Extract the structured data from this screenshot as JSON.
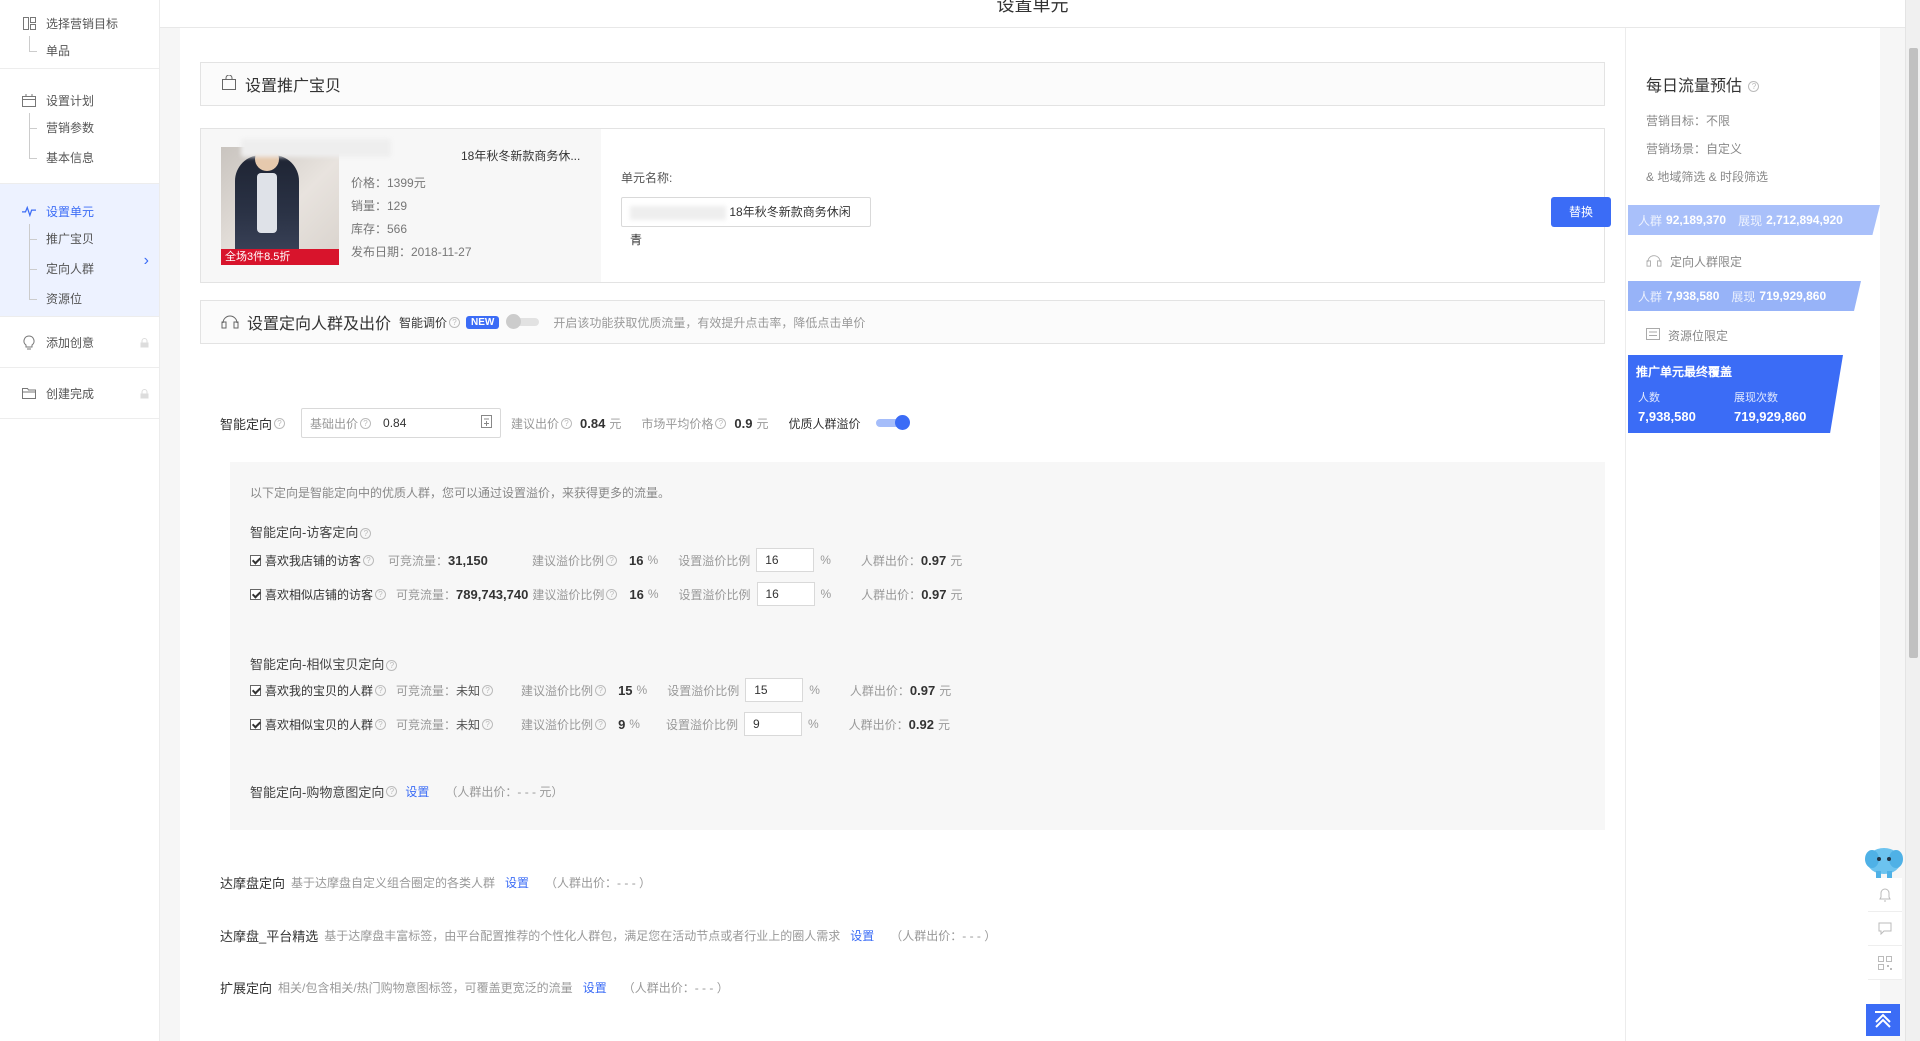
{
  "sidebar": {
    "sections": [
      {
        "title": "选择营销目标",
        "subs": [
          "单品"
        ]
      },
      {
        "title": "设置计划",
        "subs": [
          "营销参数",
          "基本信息"
        ]
      },
      {
        "title": "设置单元",
        "subs": [
          "推广宝贝",
          "定向人群",
          "资源位"
        ]
      },
      {
        "title": "添加创意",
        "subs": []
      },
      {
        "title": "创建完成",
        "subs": []
      }
    ]
  },
  "page_title": "设置单元",
  "item_section": {
    "title": "设置推广宝贝",
    "product": {
      "name_visible": "18年秋冬新款商务休...",
      "price": "价格：1399元",
      "sales": "销量：129",
      "stock": "库存：566",
      "publish_date": "发布日期：2018-11-27",
      "image_tag": "全场3件8.5折"
    },
    "unit_name_label": "单元名称:",
    "unit_name_value": "18年秋冬新款商务休闲青",
    "replace_button": "替换"
  },
  "target_section": {
    "title": "设置定向人群及出价",
    "smart_bid_label": "智能调价",
    "new_badge": "NEW",
    "smart_bid_desc": "开启该功能获取优质流量，有效提升点击率，降低点击单价",
    "smart_target_label": "智能定向",
    "base_bid_label": "基础出价",
    "base_bid_value": "0.84",
    "suggest_bid_label": "建议出价",
    "suggest_bid_value": "0.84",
    "market_avg_label": "市场平均价格",
    "market_avg_value": "0.9",
    "yuan": "元",
    "premium_label": "优质人群溢价",
    "panel_desc": "以下定向是智能定向中的优质人群，您可以通过设置溢价，来获得更多的流量。",
    "groups": [
      {
        "title": "智能定向-访客定向",
        "rows": [
          {
            "name": "喜欢我店铺的访客",
            "traffic_label": "可竞流量：",
            "traffic": "31,150",
            "suggest_label": "建议溢价比例",
            "suggest": "16",
            "set_label": "设置溢价比例",
            "set": "16",
            "crowd_label": "人群出价：",
            "crowd": "0.97"
          },
          {
            "name": "喜欢相似店铺的访客",
            "traffic_label": "可竞流量：",
            "traffic": "789,743,740",
            "suggest_label": "建议溢价比例",
            "suggest": "16",
            "set_label": "设置溢价比例",
            "set": "16",
            "crowd_label": "人群出价：",
            "crowd": "0.97"
          }
        ]
      },
      {
        "title": "智能定向-相似宝贝定向",
        "rows": [
          {
            "name": "喜欢我的宝贝的人群",
            "traffic_label": "可竞流量：",
            "traffic": "未知",
            "suggest_label": "建议溢价比例",
            "suggest": "15",
            "set_label": "设置溢价比例",
            "set": "15",
            "crowd_label": "人群出价：",
            "crowd": "0.97"
          },
          {
            "name": "喜欢相似宝贝的人群",
            "traffic_label": "可竞流量：",
            "traffic": "未知",
            "suggest_label": "建议溢价比例",
            "suggest": "9",
            "set_label": "设置溢价比例",
            "set": "9",
            "crowd_label": "人群出价：",
            "crowd": "0.92"
          }
        ]
      }
    ],
    "percent": "%",
    "shopping_intent_title": "智能定向-购物意图定向",
    "set_link": "设置",
    "shopping_intent_bid": "（人群出价：- - - 元）",
    "others": [
      {
        "title": "达摩盘定向",
        "desc": "基于达摩盘自定义组合圈定的各类人群",
        "bid": "（人群出价：- - - ）"
      },
      {
        "title": "达摩盘_平台精选",
        "desc": "基于达摩盘丰富标签，由平台配置推荐的个性化人群包，满足您在活动节点或者行业上的圈人需求",
        "bid": "（人群出价：- - - ）"
      },
      {
        "title": "扩展定向",
        "desc": "相关/包含相关/热门购物意图标签，可覆盖更宽泛的流量",
        "bid": "（人群出价：- - - ）"
      }
    ]
  },
  "right_panel": {
    "title": "每日流量预估",
    "lines": [
      "营销目标：不限",
      "营销场景：自定义",
      "& 地域筛选 & 时段筛选"
    ],
    "band1": {
      "k1": "人群",
      "v1": "92,189,370",
      "k2": "展现",
      "v2": "2,712,894,920"
    },
    "crowd_limit": "定向人群限定",
    "band2": {
      "k1": "人群",
      "v1": "7,938,580",
      "k2": "展现",
      "v2": "719,929,860"
    },
    "resource_limit": "资源位限定",
    "final": {
      "title": "推广单元最终覆盖",
      "k1": "人数",
      "k2": "展现次数",
      "v1": "7,938,580",
      "v2": "719,929,860"
    }
  },
  "colors": {
    "accent": "#3b6cf6",
    "band1": "#a9c0fa",
    "band2": "#97b3f8"
  }
}
